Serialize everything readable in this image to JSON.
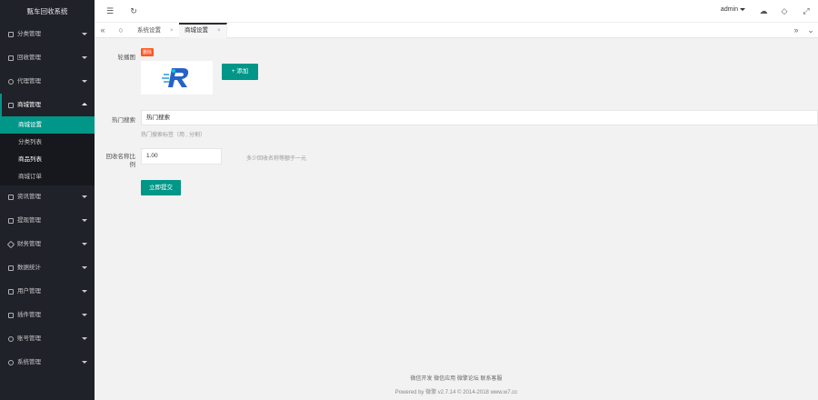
{
  "sidebar": {
    "brand": "甄车回收系统",
    "items": [
      {
        "label": "分类管理",
        "icon": "folder-icon"
      },
      {
        "label": "回收管理",
        "icon": "recycle-icon"
      },
      {
        "label": "代理管理",
        "icon": "agent-icon"
      },
      {
        "label": "商城管理",
        "icon": "cart-icon"
      }
    ],
    "submenu": [
      {
        "label": "商城设置"
      },
      {
        "label": "分类列表"
      },
      {
        "label": "商品列表"
      },
      {
        "label": "商城订单"
      }
    ],
    "items_after": [
      {
        "label": "资讯管理",
        "icon": "news-icon"
      },
      {
        "label": "提现管理",
        "icon": "withdraw-icon"
      },
      {
        "label": "财务管理",
        "icon": "finance-icon"
      },
      {
        "label": "数据统计",
        "icon": "stats-icon"
      },
      {
        "label": "用户管理",
        "icon": "user-icon"
      },
      {
        "label": "插件管理",
        "icon": "plugin-icon"
      },
      {
        "label": "账号管理",
        "icon": "account-icon"
      },
      {
        "label": "系统管理",
        "icon": "system-icon"
      }
    ]
  },
  "header": {
    "user": "admin"
  },
  "tabs": [
    {
      "label": "系统设置"
    },
    {
      "label": "商城设置"
    }
  ],
  "form": {
    "carousel_label": "轮播图",
    "badge": "删除",
    "add_button": "+ 添加",
    "hot_search_label": "热门搜索",
    "hot_search_value": "热门搜索",
    "hot_search_hint": "热门搜索标签（用 , 分割）",
    "ratio_label_1": "回收名称比",
    "ratio_label_2": "例",
    "ratio_value": "1.00",
    "ratio_hint": "多少回收名称等额于一元",
    "submit": "立即提交"
  },
  "footer": {
    "links": "微信开发  微信应用  微擎论坛  联系客服",
    "powered": "Powered by 微擎 v2.7.14 © 2014-2018 www.w7.cc"
  },
  "colors": {
    "accent": "#009688",
    "sidebar_bg": "#20222a",
    "badge": "#ff5722"
  }
}
